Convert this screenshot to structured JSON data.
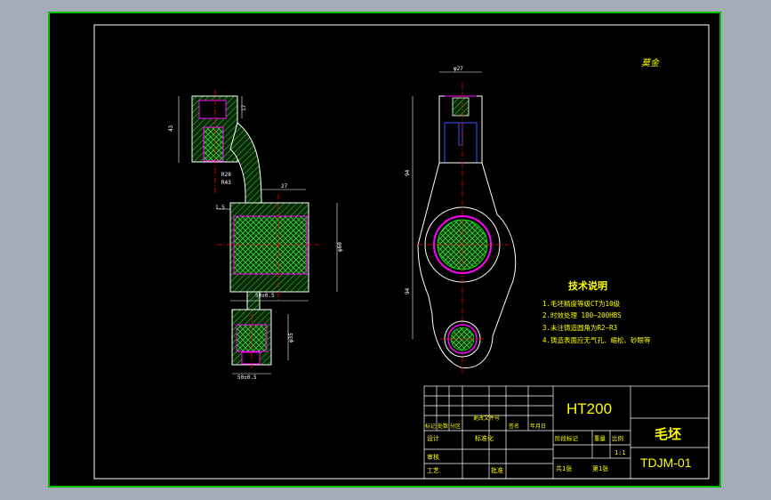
{
  "signature": "莫金",
  "dims": {
    "d27": "φ27",
    "d17": "17",
    "d43": "43",
    "r28": "R28",
    "r43": "R43",
    "w27": "27",
    "d15": "1.5",
    "phi60": "φ60",
    "w50": "50±0.5",
    "phi35": "φ35",
    "w50b": "50±0.5",
    "h94": "94",
    "h94b": "94"
  },
  "tech_notes": {
    "title": "技术说明",
    "lines": [
      "1.毛坯精度等级CT为10级",
      "2.时效处理 180—200HBS",
      "3.未注铸造圆角为R2—R3",
      "4.铸造表面应无气孔、缩松、砂眼等"
    ]
  },
  "title_block": {
    "material": "HT200",
    "part_name": "毛坯",
    "drawing_no": "TDJM-01",
    "rev_headers": [
      "标记",
      "处数",
      "分区",
      "更改文件号",
      "签名",
      "年月日"
    ],
    "row_design": "设计",
    "row_std": "标准化",
    "row_review": "审核",
    "row_process": "工艺",
    "row_approve": "批准",
    "stage_headers": [
      "阶段标记",
      "重量",
      "比例"
    ],
    "scale": "1:1",
    "sheets": "共1张",
    "sheet_no": "第1张"
  },
  "colors": {
    "frame": "#00ff00",
    "background": "#000000",
    "outline": "#ffffff",
    "hatch": "#00ff00",
    "hidden": "#ff00ff",
    "center": "#ff0000",
    "text": "#ffff00"
  }
}
